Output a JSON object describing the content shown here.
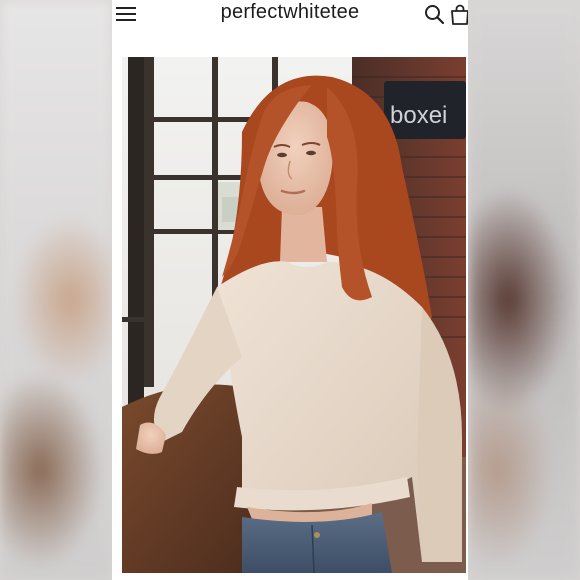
{
  "header": {
    "brand": "perfectwhitetee",
    "menu_icon": "hamburger-menu-icon",
    "search_icon": "search-icon",
    "cart_icon": "shopping-bag-icon"
  },
  "product_image": {
    "sign_text": "boxei"
  },
  "colors": {
    "background": "#ffffff",
    "text": "#1d1d1d",
    "sweater": "#e8d9cb",
    "hair": "#b4522a"
  }
}
